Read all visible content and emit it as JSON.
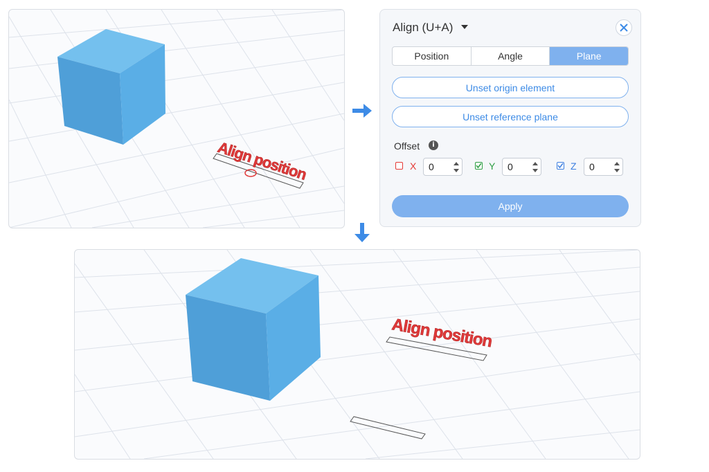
{
  "viewport_before": {
    "label_text": "Align position"
  },
  "viewport_after": {
    "label_text": "Align position"
  },
  "panel": {
    "title": "Align (U+A)",
    "tabs": [
      {
        "label": "Position",
        "active": false
      },
      {
        "label": "Angle",
        "active": false
      },
      {
        "label": "Plane",
        "active": true
      }
    ],
    "unset_origin_label": "Unset origin element",
    "unset_reference_label": "Unset reference plane",
    "offset_label": "Offset",
    "info_glyph": "i",
    "axes": [
      {
        "name": "X",
        "checked": false,
        "value": "0",
        "color": "#e53935"
      },
      {
        "name": "Y",
        "checked": true,
        "value": "0",
        "color": "#2e9e44"
      },
      {
        "name": "Z",
        "checked": true,
        "value": "0",
        "color": "#3d7fe0"
      }
    ],
    "apply_label": "Apply"
  },
  "colors": {
    "accent": "#7fb1ee",
    "cube": "#5aaee6",
    "text_red": "#e03a3a",
    "arrow": "#3d8be6"
  }
}
